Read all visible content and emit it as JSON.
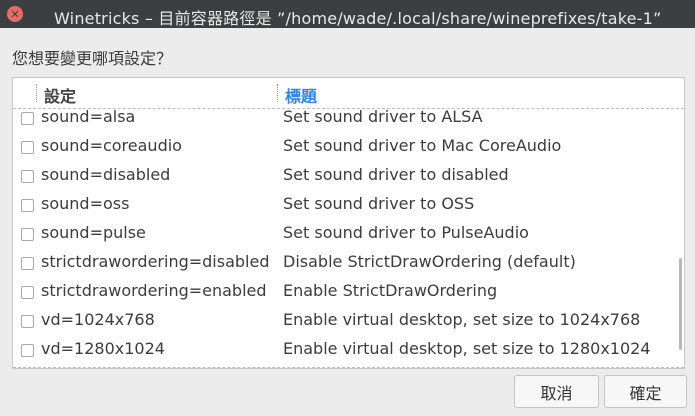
{
  "window": {
    "title": "Winetricks – 目前容器路徑是 ”/home/wade/.local/share/wineprefixes/take-1”",
    "close_icon": "close-icon"
  },
  "prompt": "您想要變更哪項設定？",
  "table": {
    "headers": {
      "setting": "設定",
      "title": "標題"
    },
    "rows": [
      {
        "setting": "sound=alsa",
        "title": "Set sound driver to ALSA",
        "checked": false
      },
      {
        "setting": "sound=coreaudio",
        "title": "Set sound driver to Mac CoreAudio",
        "checked": false
      },
      {
        "setting": "sound=disabled",
        "title": "Set sound driver to disabled",
        "checked": false
      },
      {
        "setting": "sound=oss",
        "title": "Set sound driver to OSS",
        "checked": false
      },
      {
        "setting": "sound=pulse",
        "title": "Set sound driver to PulseAudio",
        "checked": false
      },
      {
        "setting": "strictdrawordering=disabled",
        "title": "Disable StrictDrawOrdering (default)",
        "checked": false
      },
      {
        "setting": "strictdrawordering=enabled",
        "title": "Enable StrictDrawOrdering",
        "checked": false
      },
      {
        "setting": "vd=1024x768",
        "title": "Enable virtual desktop, set size to 1024x768",
        "checked": false
      },
      {
        "setting": "vd=1280x1024",
        "title": "Enable virtual desktop, set size to 1280x1024",
        "checked": false
      }
    ]
  },
  "buttons": {
    "cancel": "取消",
    "ok": "確定"
  },
  "colors": {
    "titlebar": "#3c3f41",
    "close": "#ea6a6a",
    "header_accent": "#3a86d6"
  }
}
